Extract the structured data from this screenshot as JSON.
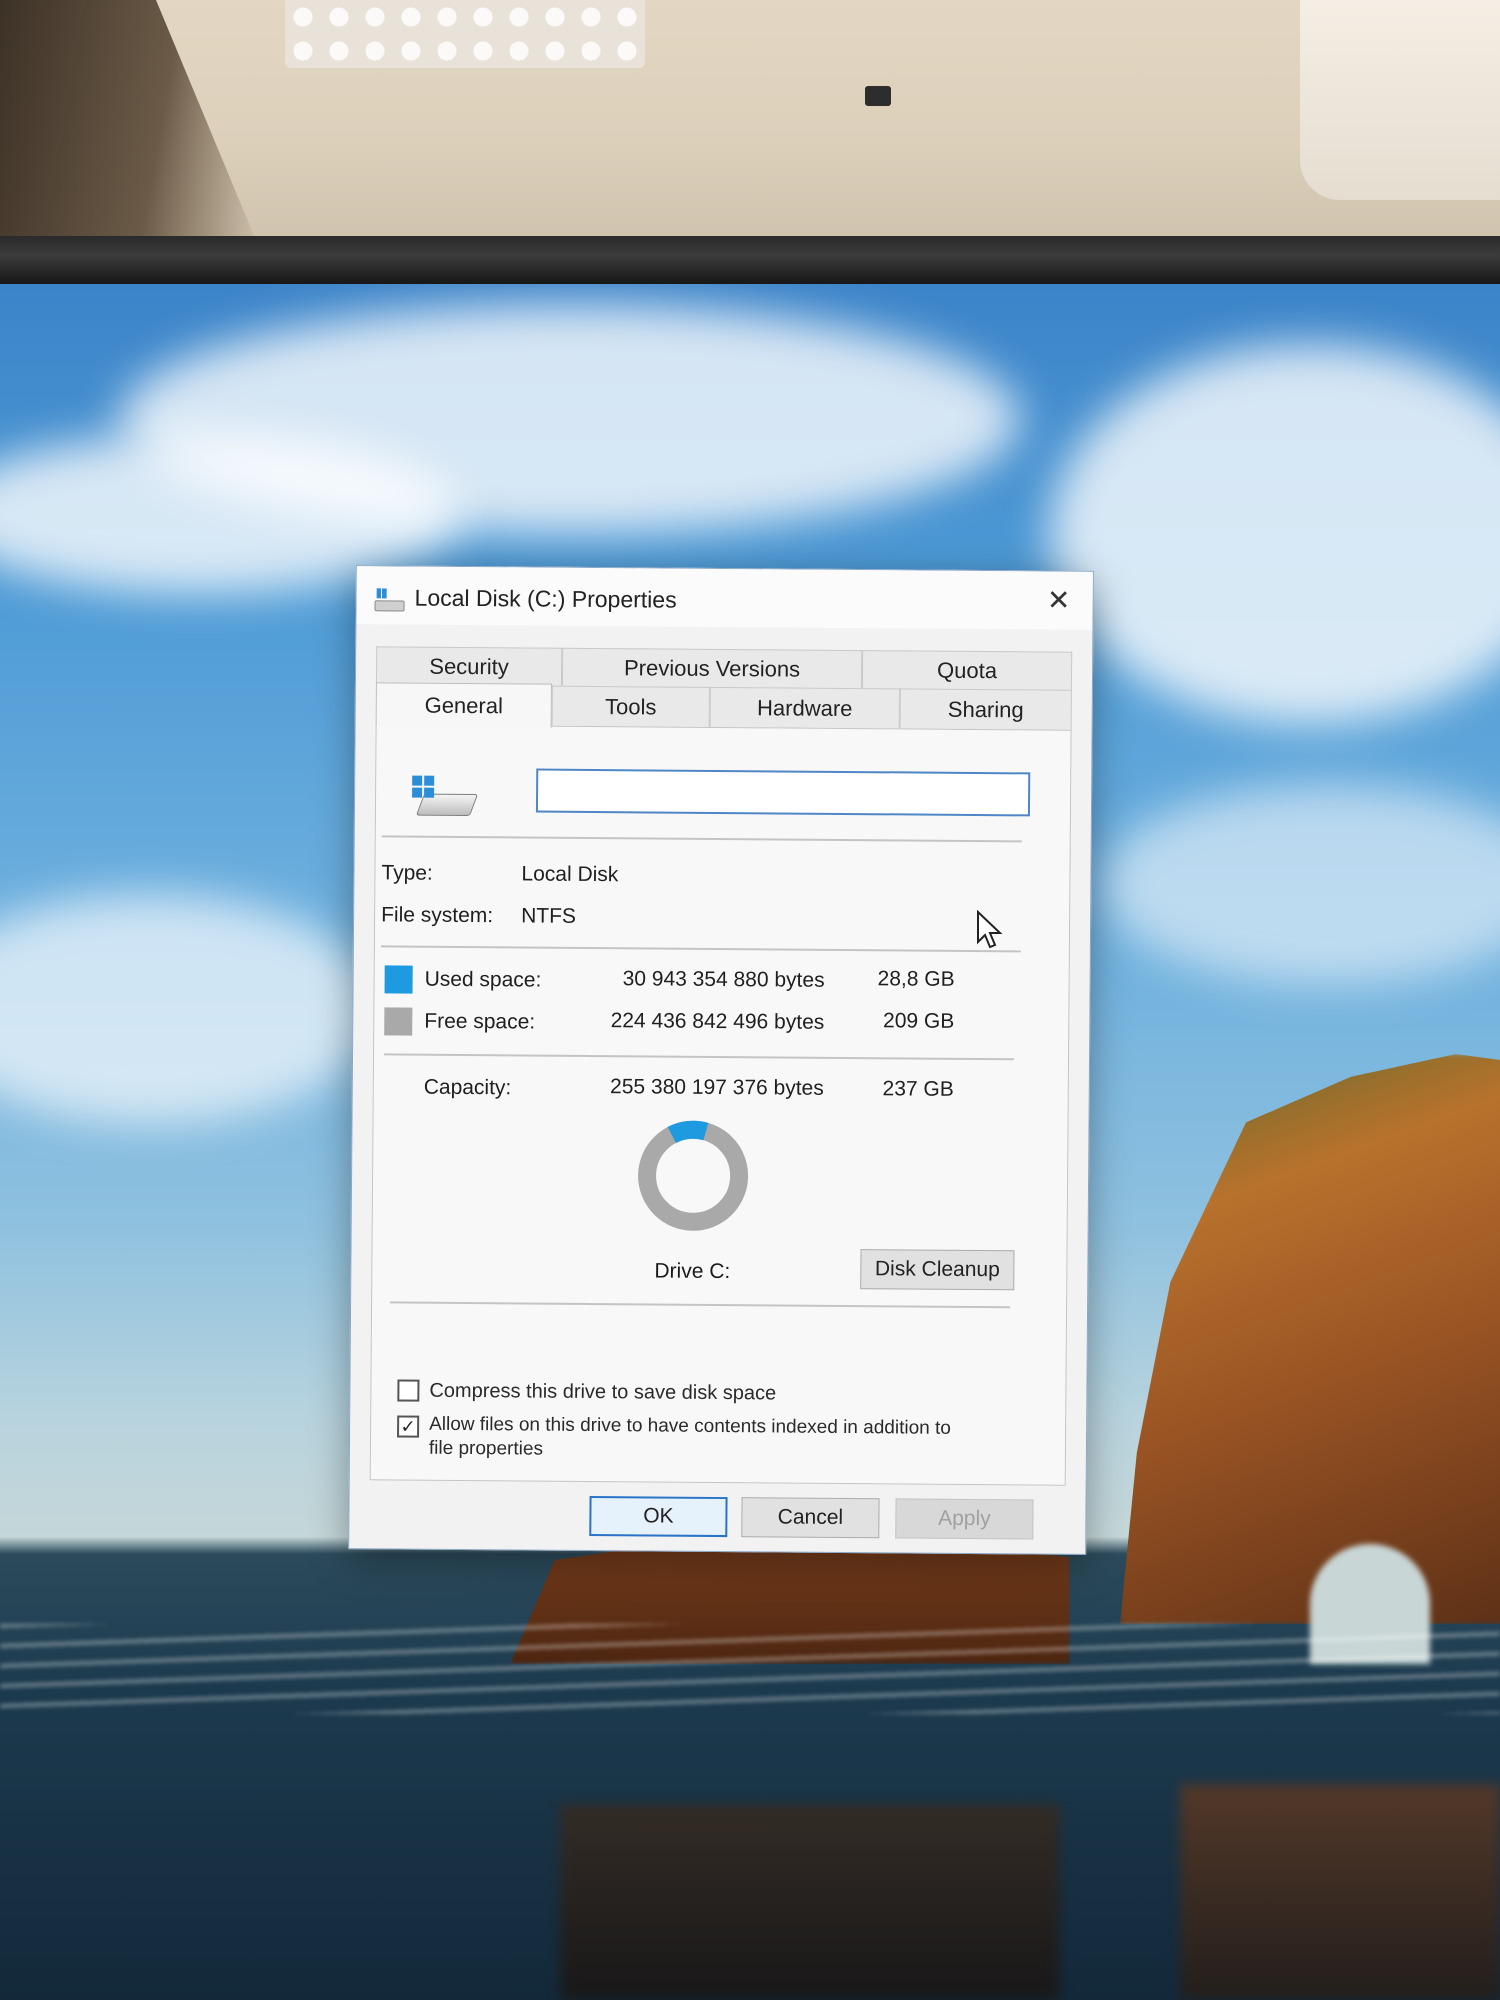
{
  "window": {
    "title": "Local Disk (C:) Properties",
    "close_glyph": "✕"
  },
  "tabs": {
    "top_row": [
      {
        "label": "Security"
      },
      {
        "label": "Previous Versions"
      },
      {
        "label": "Quota"
      }
    ],
    "bottom_row": [
      {
        "label": "General",
        "active": true
      },
      {
        "label": "Tools"
      },
      {
        "label": "Hardware"
      },
      {
        "label": "Sharing"
      }
    ]
  },
  "general": {
    "drive_name_value": "",
    "type_label": "Type:",
    "type_value": "Local Disk",
    "filesystem_label": "File system:",
    "filesystem_value": "NTFS",
    "used": {
      "label": "Used space:",
      "bytes": "30 943 354 880 bytes",
      "size": "28,8 GB",
      "color": "#1e9ae0"
    },
    "free": {
      "label": "Free space:",
      "bytes": "224 436 842 496 bytes",
      "size": "209 GB",
      "color": "#a9a9a9"
    },
    "capacity": {
      "label": "Capacity:",
      "bytes": "255 380 197 376 bytes",
      "size": "237 GB"
    },
    "usage_fraction": 0.121,
    "drive_label": "Drive C:",
    "disk_cleanup_label": "Disk Cleanup",
    "compress_label": "Compress this drive to save disk space",
    "compress_checked": false,
    "index_label_line1": "Allow files on this drive to have contents indexed in addition to",
    "index_label_line2": "file properties",
    "index_checked": true,
    "checkmark_glyph": "✓"
  },
  "buttons": {
    "ok": "OK",
    "cancel": "Cancel",
    "apply": "Apply"
  }
}
